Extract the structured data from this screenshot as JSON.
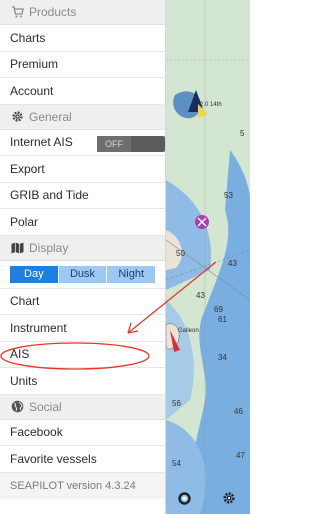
{
  "menu": {
    "products": {
      "header": "Products",
      "items": [
        "Charts",
        "Premium",
        "Account"
      ]
    },
    "general": {
      "header": "General",
      "internet_ais": "Internet AIS",
      "toggle_label": "OFF",
      "items": [
        "Export",
        "GRIB and Tide",
        "Polar"
      ]
    },
    "display": {
      "header": "Display",
      "modes": [
        "Day",
        "Dusk",
        "Night"
      ],
      "selected_mode": "Day",
      "items": [
        "Chart",
        "Instrument",
        "AIS",
        "Units"
      ]
    },
    "social": {
      "header": "Social",
      "items": [
        "Facebook",
        "Favorite vessels"
      ]
    },
    "version": "SEAPILOT version 4.3.24"
  },
  "map": {
    "depth_labels": [
      "43",
      "43",
      "34",
      "69",
      "61",
      "56",
      "54",
      "46",
      "47",
      "53",
      "50",
      "5"
    ],
    "vessel_label_1": "2.0 14th",
    "vessel_label_2": "Galleon"
  },
  "colors": {
    "selected_segment": "#1f7fe0",
    "annotation": "#e8352a",
    "deep_water": "#78aee0",
    "land": "#e9e4d6"
  },
  "icons": {
    "products": "cart-icon",
    "general": "gear-icon",
    "display": "map-icon",
    "social": "globe-icon"
  }
}
